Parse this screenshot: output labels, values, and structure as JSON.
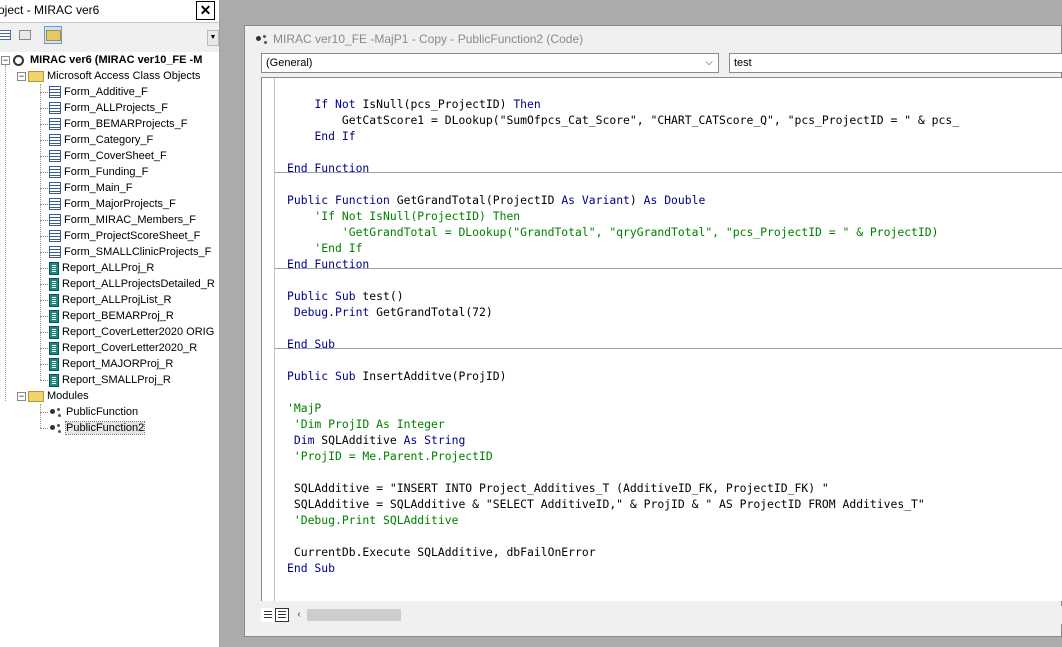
{
  "project_explorer": {
    "title": "oject - MIRAC ver6",
    "close_glyph": "✕",
    "toolbar": {
      "view_code_icon": "view-code-icon",
      "view_object_icon": "view-object-icon",
      "toggle_folders_icon": "folder-icon"
    },
    "root": {
      "label": "MIRAC ver6 (MIRAC ver10_FE -M",
      "expander": "−"
    },
    "folders": [
      {
        "label": "Microsoft Access Class Objects",
        "expander": "−",
        "items": [
          {
            "label": "Form_Additive_F",
            "icon": "form-icon"
          },
          {
            "label": "Form_ALLProjects_F",
            "icon": "form-icon"
          },
          {
            "label": "Form_BEMARProjects_F",
            "icon": "form-icon"
          },
          {
            "label": "Form_Category_F",
            "icon": "form-icon"
          },
          {
            "label": "Form_CoverSheet_F",
            "icon": "form-icon"
          },
          {
            "label": "Form_Funding_F",
            "icon": "form-icon"
          },
          {
            "label": "Form_Main_F",
            "icon": "form-icon"
          },
          {
            "label": "Form_MajorProjects_F",
            "icon": "form-icon"
          },
          {
            "label": "Form_MIRAC_Members_F",
            "icon": "form-icon"
          },
          {
            "label": "Form_ProjectScoreSheet_F",
            "icon": "form-icon"
          },
          {
            "label": "Form_SMALLClinicProjects_F",
            "icon": "form-icon"
          },
          {
            "label": "Report_ALLProj_R",
            "icon": "report-icon"
          },
          {
            "label": "Report_ALLProjectsDetailed_R",
            "icon": "report-icon"
          },
          {
            "label": "Report_ALLProjList_R",
            "icon": "report-icon"
          },
          {
            "label": "Report_BEMARProj_R",
            "icon": "report-icon"
          },
          {
            "label": "Report_CoverLetter2020 ORIG",
            "icon": "report-icon"
          },
          {
            "label": "Report_CoverLetter2020_R",
            "icon": "report-icon"
          },
          {
            "label": "Report_MAJORProj_R",
            "icon": "report-icon"
          },
          {
            "label": "Report_SMALLProj_R",
            "icon": "report-icon"
          }
        ]
      },
      {
        "label": "Modules",
        "expander": "−",
        "items": [
          {
            "label": "PublicFunction",
            "icon": "module-icon"
          },
          {
            "label": "PublicFunction2",
            "icon": "module-icon",
            "selected": true
          }
        ]
      }
    ]
  },
  "code_window": {
    "title": "MIRAC ver10_FE -MajP1 - Copy - PublicFunction2 (Code)",
    "object_combo": {
      "value": "(General)",
      "arrow": "⌵"
    },
    "procedure_combo": {
      "value": "test"
    },
    "code_lines": [
      [
        {
          "t": "    "
        },
        {
          "t": "If Not",
          "c": "kw"
        },
        {
          "t": " IsNull(pcs_ProjectID) "
        },
        {
          "t": "Then",
          "c": "kw"
        }
      ],
      [
        {
          "t": "        GetCatScore1 = DLookup(\"SumOfpcs_Cat_Score\", \"CHART_CATScore_Q\", \"pcs_ProjectID = \" & pcs_"
        }
      ],
      [
        {
          "t": "    "
        },
        {
          "t": "End If",
          "c": "kw"
        }
      ],
      [
        {
          "t": ""
        }
      ],
      [
        {
          "t": "End Function",
          "c": "kw"
        }
      ],
      [
        {
          "t": ""
        }
      ],
      [
        {
          "t": "Public Function",
          "c": "kw"
        },
        {
          "t": " GetGrandTotal(ProjectID "
        },
        {
          "t": "As Variant",
          "c": "kw"
        },
        {
          "t": ") "
        },
        {
          "t": "As Double",
          "c": "kw"
        }
      ],
      [
        {
          "t": "    'If Not IsNull(ProjectID) Then",
          "c": "cm"
        }
      ],
      [
        {
          "t": "        'GetGrandTotal = DLookup(\"GrandTotal\", \"qryGrandTotal\", \"pcs_ProjectID = \" & ProjectID)",
          "c": "cm"
        }
      ],
      [
        {
          "t": "    'End If",
          "c": "cm"
        }
      ],
      [
        {
          "t": "End Function",
          "c": "kw"
        }
      ],
      [
        {
          "t": ""
        }
      ],
      [
        {
          "t": "Public Sub",
          "c": "kw"
        },
        {
          "t": " test()"
        }
      ],
      [
        {
          "t": " "
        },
        {
          "t": "Debug",
          "c": "kw"
        },
        {
          "t": "."
        },
        {
          "t": "Print",
          "c": "kw"
        },
        {
          "t": " GetGrandTotal(72)"
        }
      ],
      [
        {
          "t": ""
        }
      ],
      [
        {
          "t": "End Sub",
          "c": "kw"
        }
      ],
      [
        {
          "t": ""
        }
      ],
      [
        {
          "t": "Public Sub",
          "c": "kw"
        },
        {
          "t": " InsertAdditve(ProjID)"
        }
      ],
      [
        {
          "t": ""
        }
      ],
      [
        {
          "t": "'MajP",
          "c": "cm"
        }
      ],
      [
        {
          "t": " 'Dim ProjID As Integer",
          "c": "cm"
        }
      ],
      [
        {
          "t": " "
        },
        {
          "t": "Dim",
          "c": "kw"
        },
        {
          "t": " SQLAdditive "
        },
        {
          "t": "As String",
          "c": "kw"
        }
      ],
      [
        {
          "t": " 'ProjID = Me.Parent.ProjectID",
          "c": "cm"
        }
      ],
      [
        {
          "t": ""
        }
      ],
      [
        {
          "t": " SQLAdditive = \"INSERT INTO Project_Additives_T (AdditiveID_FK, ProjectID_FK) \""
        }
      ],
      [
        {
          "t": " SQLAdditive = SQLAdditive & \"SELECT AdditiveID,\" & ProjID & \" AS ProjectID FROM Additives_T\""
        }
      ],
      [
        {
          "t": " 'Debug.Print SQLAdditive",
          "c": "cm"
        }
      ],
      [
        {
          "t": ""
        }
      ],
      [
        {
          "t": " CurrentDb.Execute SQLAdditive, dbFailOnError"
        }
      ],
      [
        {
          "t": "End Sub",
          "c": "kw"
        }
      ]
    ],
    "procedure_separator_after_lines": [
      5,
      11,
      16
    ],
    "status": {
      "scroll_left_glyph": "‹"
    },
    "colors": {
      "keyword": "#00008b",
      "comment": "#008000",
      "text": "#000000"
    }
  }
}
